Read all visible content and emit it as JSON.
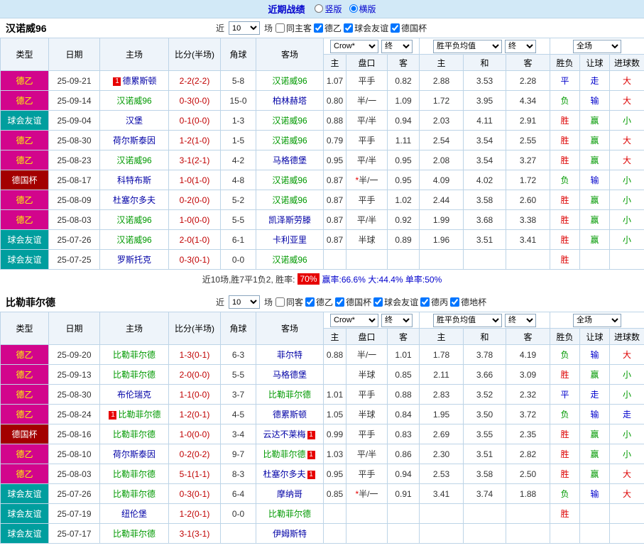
{
  "topbar": {
    "title": "近期战绩",
    "options": [
      {
        "label": "竖版",
        "selected": false
      },
      {
        "label": "横版",
        "selected": true
      }
    ]
  },
  "table_header": {
    "cols": [
      "类型",
      "日期",
      "主场",
      "比分(半场)",
      "角球",
      "客场"
    ],
    "odds_selects": [
      "Crow*",
      "终"
    ],
    "avg_selects": [
      "胜平负均值",
      "终"
    ],
    "result_select": "全场",
    "sub": [
      "主",
      "盘口",
      "客",
      "主",
      "和",
      "客",
      "胜负",
      "让球",
      "进球数"
    ]
  },
  "colors": {
    "accent-blue": "#0000cc",
    "topbar-bg": "#d2e9f7",
    "border": "#bdd4e7",
    "header-bg": "#eef4fa",
    "de2-bg": "#d2058c",
    "de2-text": "#ffff00",
    "friendly-bg": "#009e9e",
    "cup-bg": "#a30000",
    "focal-team": "#009900",
    "opp-team": "#0000a6",
    "score": "#c00000",
    "win": "#dd0000",
    "draw": "#0000cc",
    "loss": "#009900",
    "badge-red": "#e60000"
  },
  "sections": [
    {
      "team": "汉诺威96",
      "filter": {
        "near": "近",
        "count": "10",
        "unit": "场",
        "checkboxes": [
          {
            "label": "同主客",
            "checked": false
          },
          {
            "label": "德乙",
            "checked": true
          },
          {
            "label": "球会友谊",
            "checked": true
          },
          {
            "label": "德国杯",
            "checked": true
          }
        ]
      },
      "rows": [
        {
          "type": "德乙",
          "date": "25-09-21",
          "home": "德累斯顿",
          "home_badge": "1",
          "home_focal": false,
          "score": "2-2(2-2)",
          "corners": "5-8",
          "away": "汉诺威96",
          "away_badge": "",
          "away_focal": true,
          "odds_home": "1.07",
          "handicap": "平手",
          "odds_away": "0.82",
          "avg_home": "2.88",
          "avg_draw": "3.53",
          "avg_away": "2.28",
          "res_wdl": "平",
          "res_let": "走",
          "res_goal": "大"
        },
        {
          "type": "德乙",
          "date": "25-09-14",
          "home": "汉诺威96",
          "home_badge": "",
          "home_focal": true,
          "score": "0-3(0-0)",
          "corners": "15-0",
          "away": "柏林赫塔",
          "away_badge": "",
          "away_focal": false,
          "odds_home": "0.80",
          "handicap": "半/一",
          "odds_away": "1.09",
          "avg_home": "1.72",
          "avg_draw": "3.95",
          "avg_away": "4.34",
          "res_wdl": "负",
          "res_let": "输",
          "res_goal": "大"
        },
        {
          "type": "球会友谊",
          "date": "25-09-04",
          "home": "汉堡",
          "home_badge": "",
          "home_focal": false,
          "score": "0-1(0-0)",
          "corners": "1-3",
          "away": "汉诺威96",
          "away_badge": "",
          "away_focal": true,
          "odds_home": "0.88",
          "handicap": "平/半",
          "odds_away": "0.94",
          "avg_home": "2.03",
          "avg_draw": "4.11",
          "avg_away": "2.91",
          "res_wdl": "胜",
          "res_let": "赢",
          "res_goal": "小"
        },
        {
          "type": "德乙",
          "date": "25-08-30",
          "home": "荷尔斯泰因",
          "home_badge": "",
          "home_focal": false,
          "score": "1-2(1-0)",
          "corners": "1-5",
          "away": "汉诺威96",
          "away_badge": "",
          "away_focal": true,
          "odds_home": "0.79",
          "handicap": "平手",
          "odds_away": "1.11",
          "avg_home": "2.54",
          "avg_draw": "3.54",
          "avg_away": "2.55",
          "res_wdl": "胜",
          "res_let": "赢",
          "res_goal": "大"
        },
        {
          "type": "德乙",
          "date": "25-08-23",
          "home": "汉诺威96",
          "home_badge": "",
          "home_focal": true,
          "score": "3-1(2-1)",
          "corners": "4-2",
          "away": "马格德堡",
          "away_badge": "",
          "away_focal": false,
          "odds_home": "0.95",
          "handicap": "平/半",
          "odds_away": "0.95",
          "avg_home": "2.08",
          "avg_draw": "3.54",
          "avg_away": "3.27",
          "res_wdl": "胜",
          "res_let": "赢",
          "res_goal": "大"
        },
        {
          "type": "德国杯",
          "date": "25-08-17",
          "home": "科特布斯",
          "home_badge": "",
          "home_focal": false,
          "score": "1-0(1-0)",
          "corners": "4-8",
          "away": "汉诺威96",
          "away_badge": "",
          "away_focal": true,
          "odds_home": "0.87",
          "handicap": "*半/一",
          "odds_away": "0.95",
          "avg_home": "4.09",
          "avg_draw": "4.02",
          "avg_away": "1.72",
          "res_wdl": "负",
          "res_let": "输",
          "res_goal": "小"
        },
        {
          "type": "德乙",
          "date": "25-08-09",
          "home": "杜塞尔多夫",
          "home_badge": "",
          "home_focal": false,
          "score": "0-2(0-0)",
          "corners": "5-2",
          "away": "汉诺威96",
          "away_badge": "",
          "away_focal": true,
          "odds_home": "0.87",
          "handicap": "平手",
          "odds_away": "1.02",
          "avg_home": "2.44",
          "avg_draw": "3.58",
          "avg_away": "2.60",
          "res_wdl": "胜",
          "res_let": "赢",
          "res_goal": "小"
        },
        {
          "type": "德乙",
          "date": "25-08-03",
          "home": "汉诺威96",
          "home_badge": "",
          "home_focal": true,
          "score": "1-0(0-0)",
          "corners": "5-5",
          "away": "凯泽斯劳滕",
          "away_badge": "",
          "away_focal": false,
          "odds_home": "0.87",
          "handicap": "平/半",
          "odds_away": "0.92",
          "avg_home": "1.99",
          "avg_draw": "3.68",
          "avg_away": "3.38",
          "res_wdl": "胜",
          "res_let": "赢",
          "res_goal": "小"
        },
        {
          "type": "球会友谊",
          "date": "25-07-26",
          "home": "汉诺威96",
          "home_badge": "",
          "home_focal": true,
          "score": "2-0(1-0)",
          "corners": "6-1",
          "away": "卡利亚里",
          "away_badge": "",
          "away_focal": false,
          "odds_home": "0.87",
          "handicap": "半球",
          "odds_away": "0.89",
          "avg_home": "1.96",
          "avg_draw": "3.51",
          "avg_away": "3.41",
          "res_wdl": "胜",
          "res_let": "赢",
          "res_goal": "小"
        },
        {
          "type": "球会友谊",
          "date": "25-07-25",
          "home": "罗斯托克",
          "home_badge": "",
          "home_focal": false,
          "score": "0-3(0-1)",
          "corners": "0-0",
          "away": "汉诺威96",
          "away_badge": "",
          "away_focal": true,
          "odds_home": "",
          "handicap": "",
          "odds_away": "",
          "avg_home": "",
          "avg_draw": "",
          "avg_away": "",
          "res_wdl": "胜",
          "res_let": "",
          "res_goal": ""
        }
      ],
      "summary": {
        "prefix": "近10场,胜7平1负2, 胜率:",
        "rate": "70%",
        "stats": "赢率:66.6% 大:44.4% 单率:50%"
      }
    },
    {
      "team": "比勒菲尔德",
      "filter": {
        "near": "近",
        "count": "10",
        "unit": "场",
        "checkboxes": [
          {
            "label": "同客",
            "checked": false
          },
          {
            "label": "德乙",
            "checked": true
          },
          {
            "label": "德国杯",
            "checked": true
          },
          {
            "label": "球会友谊",
            "checked": true
          },
          {
            "label": "德丙",
            "checked": true
          },
          {
            "label": "德地杯",
            "checked": true
          }
        ]
      },
      "rows": [
        {
          "type": "德乙",
          "date": "25-09-20",
          "home": "比勒菲尔德",
          "home_badge": "",
          "home_focal": true,
          "score": "1-3(0-1)",
          "corners": "6-3",
          "away": "菲尔特",
          "away_badge": "",
          "away_focal": false,
          "odds_home": "0.88",
          "handicap": "半/一",
          "odds_away": "1.01",
          "avg_home": "1.78",
          "avg_draw": "3.78",
          "avg_away": "4.19",
          "res_wdl": "负",
          "res_let": "输",
          "res_goal": "大"
        },
        {
          "type": "德乙",
          "date": "25-09-13",
          "home": "比勒菲尔德",
          "home_badge": "",
          "home_focal": true,
          "score": "2-0(0-0)",
          "corners": "5-5",
          "away": "马格德堡",
          "away_badge": "",
          "away_focal": false,
          "odds_home": "",
          "handicap": "半球",
          "odds_away": "0.85",
          "avg_home": "2.11",
          "avg_draw": "3.66",
          "avg_away": "3.09",
          "res_wdl": "胜",
          "res_let": "赢",
          "res_goal": "小"
        },
        {
          "type": "德乙",
          "date": "25-08-30",
          "home": "布伦瑞克",
          "home_badge": "",
          "home_focal": false,
          "score": "1-1(0-0)",
          "corners": "3-7",
          "away": "比勒菲尔德",
          "away_badge": "",
          "away_focal": true,
          "odds_home": "1.01",
          "handicap": "平手",
          "odds_away": "0.88",
          "avg_home": "2.83",
          "avg_draw": "3.52",
          "avg_away": "2.32",
          "res_wdl": "平",
          "res_let": "走",
          "res_goal": "小"
        },
        {
          "type": "德乙",
          "date": "25-08-24",
          "home": "比勒菲尔德",
          "home_badge": "1",
          "home_focal": true,
          "score": "1-2(0-1)",
          "corners": "4-5",
          "away": "德累斯顿",
          "away_badge": "",
          "away_focal": false,
          "odds_home": "1.05",
          "handicap": "半球",
          "odds_away": "0.84",
          "avg_home": "1.95",
          "avg_draw": "3.50",
          "avg_away": "3.72",
          "res_wdl": "负",
          "res_let": "输",
          "res_goal": "走"
        },
        {
          "type": "德国杯",
          "date": "25-08-16",
          "home": "比勒菲尔德",
          "home_badge": "",
          "home_focal": true,
          "score": "1-0(0-0)",
          "corners": "3-4",
          "away": "云达不莱梅",
          "away_badge": "1",
          "away_focal": false,
          "odds_home": "0.99",
          "handicap": "平手",
          "odds_away": "0.83",
          "avg_home": "2.69",
          "avg_draw": "3.55",
          "avg_away": "2.35",
          "res_wdl": "胜",
          "res_let": "赢",
          "res_goal": "小"
        },
        {
          "type": "德乙",
          "date": "25-08-10",
          "home": "荷尔斯泰因",
          "home_badge": "",
          "home_focal": false,
          "score": "0-2(0-2)",
          "corners": "9-7",
          "away": "比勒菲尔德",
          "away_badge": "1",
          "away_focal": true,
          "odds_home": "1.03",
          "handicap": "平/半",
          "odds_away": "0.86",
          "avg_home": "2.30",
          "avg_draw": "3.51",
          "avg_away": "2.82",
          "res_wdl": "胜",
          "res_let": "赢",
          "res_goal": "小"
        },
        {
          "type": "德乙",
          "date": "25-08-03",
          "home": "比勒菲尔德",
          "home_badge": "",
          "home_focal": true,
          "score": "5-1(1-1)",
          "corners": "8-3",
          "away": "杜塞尔多夫",
          "away_badge": "1",
          "away_focal": false,
          "odds_home": "0.95",
          "handicap": "平手",
          "odds_away": "0.94",
          "avg_home": "2.53",
          "avg_draw": "3.58",
          "avg_away": "2.50",
          "res_wdl": "胜",
          "res_let": "赢",
          "res_goal": "大"
        },
        {
          "type": "球会友谊",
          "date": "25-07-26",
          "home": "比勒菲尔德",
          "home_badge": "",
          "home_focal": true,
          "score": "0-3(0-1)",
          "corners": "6-4",
          "away": "摩纳哥",
          "away_badge": "",
          "away_focal": false,
          "odds_home": "0.85",
          "handicap": "*半/一",
          "odds_away": "0.91",
          "avg_home": "3.41",
          "avg_draw": "3.74",
          "avg_away": "1.88",
          "res_wdl": "负",
          "res_let": "输",
          "res_goal": "大"
        },
        {
          "type": "球会友谊",
          "date": "25-07-19",
          "home": "纽伦堡",
          "home_badge": "",
          "home_focal": false,
          "score": "1-2(0-1)",
          "corners": "0-0",
          "away": "比勒菲尔德",
          "away_badge": "",
          "away_focal": true,
          "odds_home": "",
          "handicap": "",
          "odds_away": "",
          "avg_home": "",
          "avg_draw": "",
          "avg_away": "",
          "res_wdl": "胜",
          "res_let": "",
          "res_goal": ""
        },
        {
          "type": "球会友谊",
          "date": "25-07-17",
          "home": "比勒菲尔德",
          "home_badge": "",
          "home_focal": true,
          "score": "3-1(3-1)",
          "corners": "",
          "away": "伊姆斯特",
          "away_badge": "",
          "away_focal": false,
          "odds_home": "",
          "handicap": "",
          "odds_away": "",
          "avg_home": "",
          "avg_draw": "",
          "avg_away": "",
          "res_wdl": "",
          "res_let": "",
          "res_goal": ""
        }
      ],
      "summary": null
    }
  ]
}
